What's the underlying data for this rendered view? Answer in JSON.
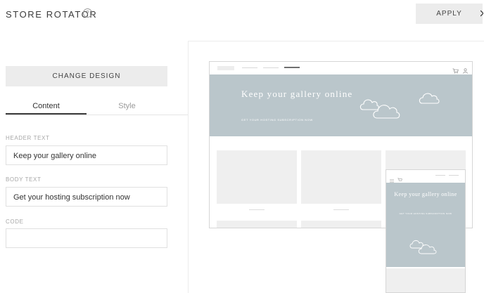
{
  "header": {
    "title": "STORE ROTATOR",
    "help_icon": "?",
    "apply_label": "APPLY"
  },
  "panel": {
    "change_design_label": "CHANGE DESIGN",
    "tabs": [
      {
        "label": "Content",
        "active": true
      },
      {
        "label": "Style",
        "active": false
      }
    ],
    "fields": {
      "header_text": {
        "label": "HEADER TEXT",
        "value": "Keep your gallery online"
      },
      "body_text": {
        "label": "BODY TEXT",
        "value": "Get your hosting subscription now"
      },
      "code": {
        "label": "CODE",
        "value": ""
      }
    }
  },
  "preview": {
    "desktop": {
      "hero_title": "Keep your gallery online",
      "hero_subtitle": "GET YOUR HOSTING SUBSCRIPTION NOW",
      "icons": [
        "cart-icon",
        "user-icon",
        "cloud-icon"
      ]
    },
    "mobile": {
      "hero_title": "Keep your gallery online",
      "hero_subtitle": "GET YOUR HOSTING SUBSCRIPTION NOW",
      "icons": [
        "menu-icon",
        "cart-icon",
        "cloud-icon"
      ]
    }
  },
  "colors": {
    "hero_background": "#bac6cb",
    "button_background": "#ececec",
    "tile_background": "#efefef"
  }
}
